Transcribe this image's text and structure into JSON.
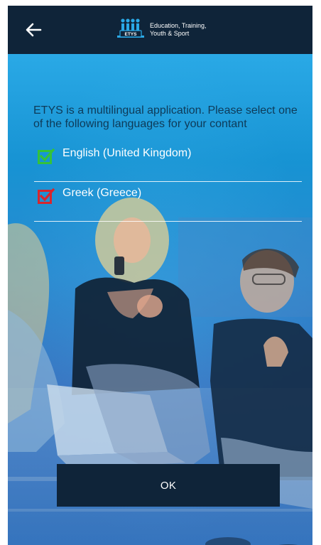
{
  "header": {
    "logo_badge": "ETYS",
    "logo_line1": "Education, Training,",
    "logo_line2": "Youth & Sport"
  },
  "intro": {
    "text": "ETYS is a multilingual application. Please select one of the following languages for your contant"
  },
  "languages": [
    {
      "label": "English (United Kingdom)",
      "checked": true,
      "color": "#34c23a"
    },
    {
      "label": "Greek (Greece)",
      "checked": true,
      "color": "#d7262e"
    }
  ],
  "actions": {
    "ok_label": "OK"
  },
  "colors": {
    "header_bg": "#0f2439",
    "overlay_top": "#2aa9e6",
    "overlay_bottom": "#2f77c1"
  }
}
